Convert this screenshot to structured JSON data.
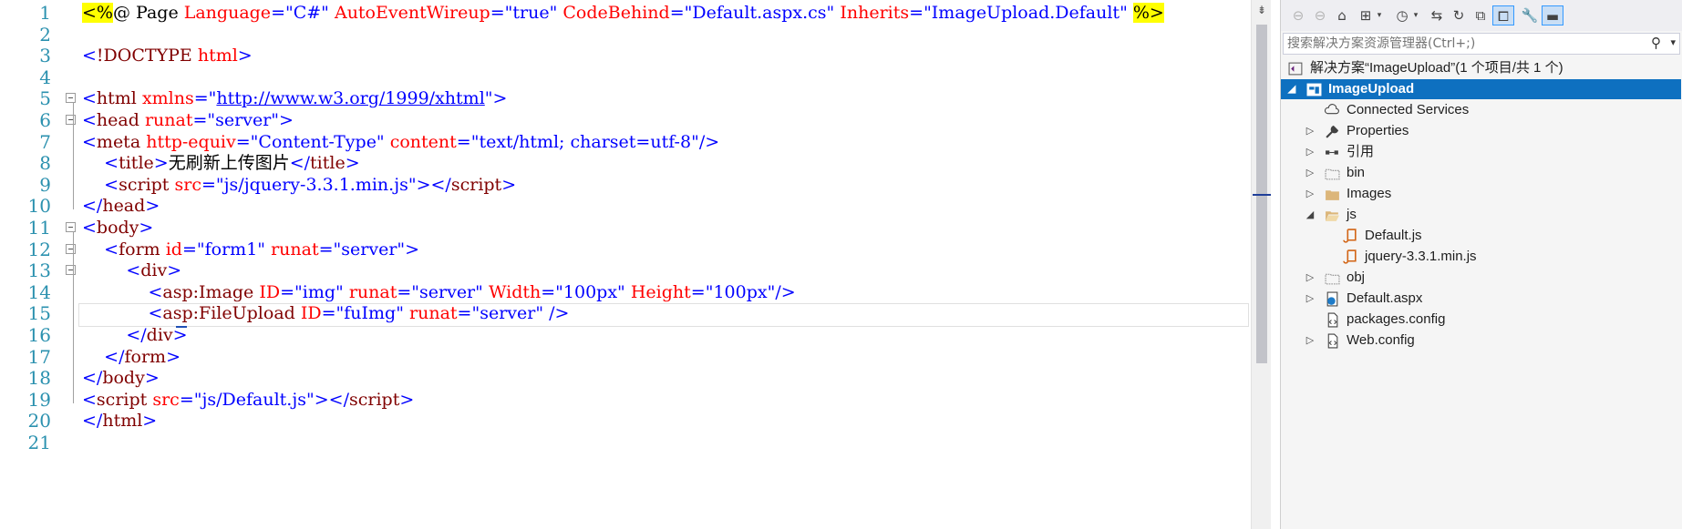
{
  "editor": {
    "line_numbers": [
      "1",
      "2",
      "3",
      "4",
      "5",
      "6",
      "7",
      "8",
      "9",
      "10",
      "11",
      "12",
      "13",
      "14",
      "15",
      "16",
      "17",
      "18",
      "19",
      "20",
      "21"
    ],
    "lines": [
      [
        [
          "dir",
          "<%"
        ],
        [
          "text",
          "@ Page "
        ],
        [
          "attr",
          "Language"
        ],
        [
          "delim",
          "="
        ],
        [
          "val",
          "\"C#\""
        ],
        [
          "text",
          " "
        ],
        [
          "attr",
          "AutoEventWireup"
        ],
        [
          "delim",
          "="
        ],
        [
          "val",
          "\"true\""
        ],
        [
          "text",
          " "
        ],
        [
          "attr",
          "CodeBehind"
        ],
        [
          "delim",
          "="
        ],
        [
          "val",
          "\"Default.aspx.cs\""
        ],
        [
          "text",
          " "
        ],
        [
          "attr",
          "Inherits"
        ],
        [
          "delim",
          "="
        ],
        [
          "val",
          "\"ImageUpload.Default\""
        ],
        [
          "text",
          " "
        ],
        [
          "dir",
          "%>"
        ]
      ],
      [],
      [
        [
          "delim",
          "<"
        ],
        [
          "tag",
          "!DOCTYPE"
        ],
        [
          "text",
          " "
        ],
        [
          "attr",
          "html"
        ],
        [
          "delim",
          ">"
        ]
      ],
      [],
      [
        [
          "delim",
          "<"
        ],
        [
          "tag",
          "html"
        ],
        [
          "text",
          " "
        ],
        [
          "attr",
          "xmlns"
        ],
        [
          "delim",
          "="
        ],
        [
          "q",
          "\""
        ],
        [
          "url",
          "http://www.w3.org/1999/xhtml"
        ],
        [
          "q",
          "\""
        ],
        [
          "delim",
          ">"
        ]
      ],
      [
        [
          "delim",
          "<"
        ],
        [
          "tag",
          "head"
        ],
        [
          "text",
          " "
        ],
        [
          "attr",
          "runat"
        ],
        [
          "delim",
          "="
        ],
        [
          "val",
          "\"server\""
        ],
        [
          "delim",
          ">"
        ]
      ],
      [
        [
          "delim",
          "<"
        ],
        [
          "tag",
          "meta"
        ],
        [
          "text",
          " "
        ],
        [
          "attr",
          "http-equiv"
        ],
        [
          "delim",
          "="
        ],
        [
          "val",
          "\"Content-Type\""
        ],
        [
          "text",
          " "
        ],
        [
          "attr",
          "content"
        ],
        [
          "delim",
          "="
        ],
        [
          "val",
          "\"text/html; charset=utf-8\""
        ],
        [
          "delim",
          "/>"
        ]
      ],
      [
        [
          "text",
          "    "
        ],
        [
          "delim",
          "<"
        ],
        [
          "tag",
          "title"
        ],
        [
          "delim",
          ">"
        ],
        [
          "text",
          "无刷新上传图片"
        ],
        [
          "delim",
          "</"
        ],
        [
          "tag",
          "title"
        ],
        [
          "delim",
          ">"
        ]
      ],
      [
        [
          "text",
          "    "
        ],
        [
          "delim",
          "<"
        ],
        [
          "tag",
          "script"
        ],
        [
          "text",
          " "
        ],
        [
          "attr",
          "src"
        ],
        [
          "delim",
          "="
        ],
        [
          "val",
          "\"js/jquery-3.3.1.min.js\""
        ],
        [
          "delim",
          "></"
        ],
        [
          "tag",
          "script"
        ],
        [
          "delim",
          ">"
        ]
      ],
      [
        [
          "delim",
          "</"
        ],
        [
          "tag",
          "head"
        ],
        [
          "delim",
          ">"
        ]
      ],
      [
        [
          "delim",
          "<"
        ],
        [
          "tag",
          "body"
        ],
        [
          "delim",
          ">"
        ]
      ],
      [
        [
          "text",
          "    "
        ],
        [
          "delim",
          "<"
        ],
        [
          "tag",
          "form"
        ],
        [
          "text",
          " "
        ],
        [
          "attr",
          "id"
        ],
        [
          "delim",
          "="
        ],
        [
          "val",
          "\"form1\""
        ],
        [
          "text",
          " "
        ],
        [
          "attr",
          "runat"
        ],
        [
          "delim",
          "="
        ],
        [
          "val",
          "\"server\""
        ],
        [
          "delim",
          ">"
        ]
      ],
      [
        [
          "text",
          "        "
        ],
        [
          "delim",
          "<"
        ],
        [
          "tag",
          "div"
        ],
        [
          "delim",
          ">"
        ]
      ],
      [
        [
          "text",
          "            "
        ],
        [
          "delim",
          "<"
        ],
        [
          "tag",
          "asp:Image"
        ],
        [
          "text",
          " "
        ],
        [
          "attr",
          "ID"
        ],
        [
          "delim",
          "="
        ],
        [
          "val",
          "\"img\""
        ],
        [
          "text",
          " "
        ],
        [
          "attr",
          "runat"
        ],
        [
          "delim",
          "="
        ],
        [
          "val",
          "\"server\""
        ],
        [
          "text",
          " "
        ],
        [
          "attr",
          "Width"
        ],
        [
          "delim",
          "="
        ],
        [
          "val",
          "\"100px\""
        ],
        [
          "text",
          " "
        ],
        [
          "attr",
          "Height"
        ],
        [
          "delim",
          "="
        ],
        [
          "val",
          "\"100px\""
        ],
        [
          "delim",
          "/>"
        ]
      ],
      [
        [
          "text",
          "            "
        ],
        [
          "delim",
          "<"
        ],
        [
          "tag",
          "asp:FileUpload"
        ],
        [
          "text",
          " "
        ],
        [
          "attr",
          "ID"
        ],
        [
          "delim",
          "="
        ],
        [
          "val",
          "\"fuImg\""
        ],
        [
          "text",
          " "
        ],
        [
          "attr",
          "runat"
        ],
        [
          "delim",
          "="
        ],
        [
          "val",
          "\"server\""
        ],
        [
          "text",
          " "
        ],
        [
          "delim",
          "/>"
        ]
      ],
      [
        [
          "text",
          "        "
        ],
        [
          "delim",
          "</"
        ],
        [
          "tag",
          "div"
        ],
        [
          "delim",
          ">"
        ]
      ],
      [
        [
          "text",
          "    "
        ],
        [
          "delim",
          "</"
        ],
        [
          "tag",
          "form"
        ],
        [
          "delim",
          ">"
        ]
      ],
      [
        [
          "delim",
          "</"
        ],
        [
          "tag",
          "body"
        ],
        [
          "delim",
          ">"
        ]
      ],
      [
        [
          "delim",
          "<"
        ],
        [
          "tag",
          "script"
        ],
        [
          "text",
          " "
        ],
        [
          "attr",
          "src"
        ],
        [
          "delim",
          "="
        ],
        [
          "val",
          "\"js/Default.js\""
        ],
        [
          "delim",
          "></"
        ],
        [
          "tag",
          "script"
        ],
        [
          "delim",
          ">"
        ]
      ],
      [
        [
          "delim",
          "</"
        ],
        [
          "tag",
          "html"
        ],
        [
          "delim",
          ">"
        ]
      ],
      []
    ],
    "fold_lines": [
      5,
      6,
      11,
      12,
      13
    ],
    "colors": {
      "line_number": "#2b91af",
      "tag": "#800000",
      "attribute": "#ff0000",
      "value": "#0000ff",
      "directive_bg": "#ffff00"
    }
  },
  "explorer": {
    "toolbar_icons": [
      "back-icon",
      "forward-icon",
      "home-icon",
      "switch-views-icon",
      "dropdown-icon",
      "pending-changes-icon",
      "dropdown-icon",
      "sync-icon",
      "refresh-icon",
      "collapse-all-icon",
      "show-all-files-icon",
      "properties-wrench-icon",
      "preview-icon"
    ],
    "search_placeholder": "搜索解决方案资源管理器(Ctrl+;)",
    "items": [
      {
        "label": "解决方案“ImageUpload”(1 个项目/共 1 个)",
        "icon": "solution-icon",
        "arrow": "",
        "depth": 0
      },
      {
        "label": "ImageUpload",
        "icon": "project-icon",
        "arrow": "expanded",
        "depth": 0,
        "selected": true
      },
      {
        "label": "Connected Services",
        "icon": "connected-services-icon",
        "arrow": "",
        "depth": 1
      },
      {
        "label": "Properties",
        "icon": "wrench-icon",
        "arrow": "collapsed",
        "depth": 1
      },
      {
        "label": "引用",
        "icon": "references-icon",
        "arrow": "collapsed",
        "depth": 1
      },
      {
        "label": "bin",
        "icon": "folder-outline-icon",
        "arrow": "collapsed",
        "depth": 1
      },
      {
        "label": "Images",
        "icon": "folder-icon",
        "arrow": "collapsed",
        "depth": 1
      },
      {
        "label": "js",
        "icon": "folder-open-icon",
        "arrow": "expanded",
        "depth": 1
      },
      {
        "label": "Default.js",
        "icon": "js-file-icon",
        "arrow": "",
        "depth": 2
      },
      {
        "label": "jquery-3.3.1.min.js",
        "icon": "js-file-icon",
        "arrow": "",
        "depth": 2
      },
      {
        "label": "obj",
        "icon": "folder-outline-icon",
        "arrow": "collapsed",
        "depth": 1
      },
      {
        "label": "Default.aspx",
        "icon": "aspx-file-icon",
        "arrow": "collapsed",
        "depth": 1
      },
      {
        "label": "packages.config",
        "icon": "config-file-icon",
        "arrow": "",
        "depth": 1
      },
      {
        "label": "Web.config",
        "icon": "config-file-icon",
        "arrow": "collapsed",
        "depth": 1
      }
    ]
  }
}
